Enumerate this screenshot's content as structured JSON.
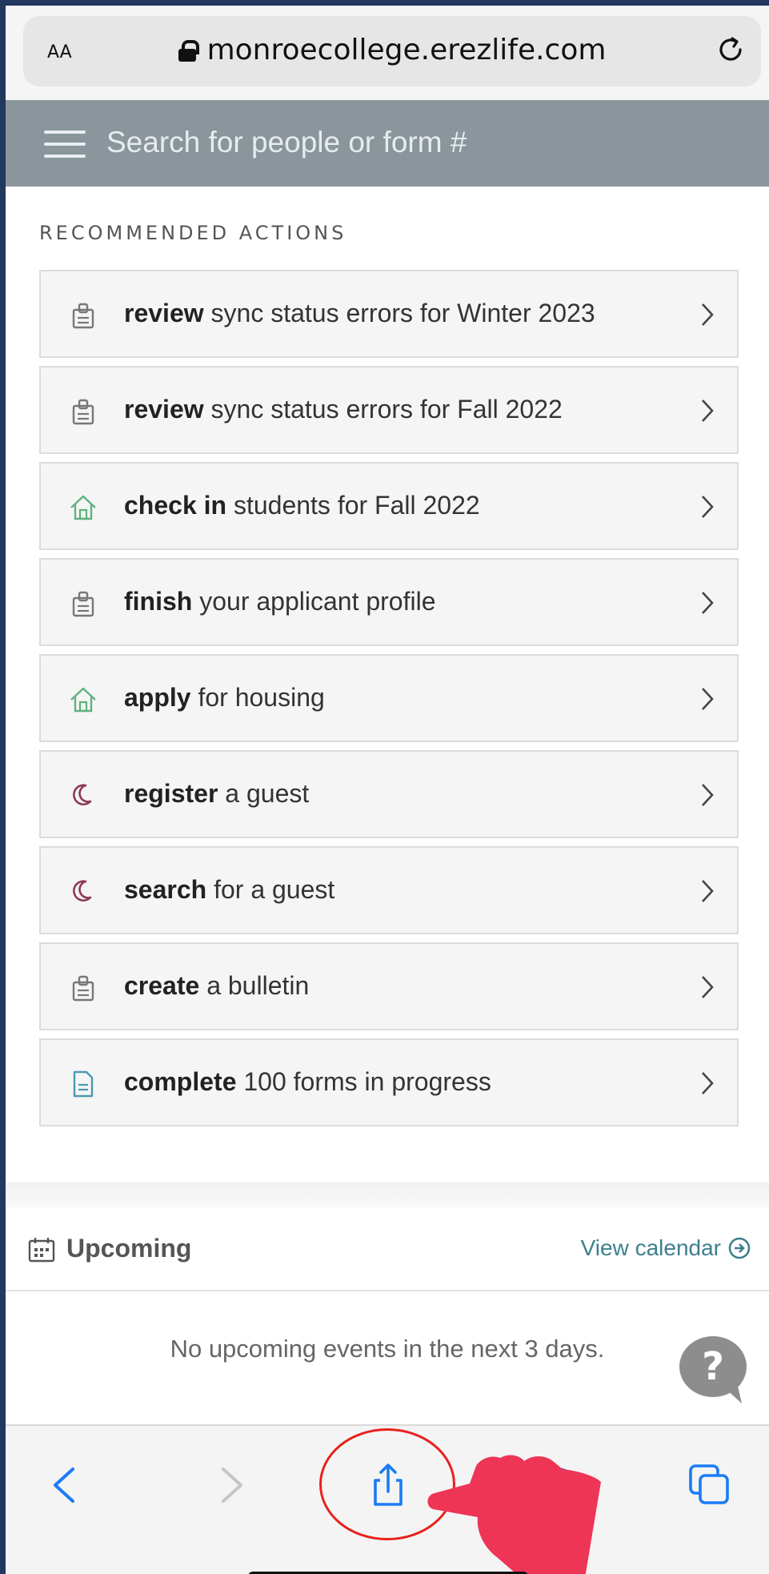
{
  "browser": {
    "text_size_label": "AA",
    "url": "monroecollege.erezlife.com"
  },
  "header": {
    "search_placeholder": "Search for people or form #"
  },
  "recommended": {
    "title": "RECOMMENDED ACTIONS",
    "items": [
      {
        "verb": "review",
        "rest": " sync status errors for Winter 2023",
        "icon": "clipboard-icon"
      },
      {
        "verb": "review",
        "rest": " sync status errors for Fall 2022",
        "icon": "clipboard-icon"
      },
      {
        "verb": "check in",
        "rest": " students for Fall 2022",
        "icon": "house-icon"
      },
      {
        "verb": "finish",
        "rest": " your applicant profile",
        "icon": "clipboard-icon"
      },
      {
        "verb": "apply",
        "rest": " for housing",
        "icon": "house-icon"
      },
      {
        "verb": "register",
        "rest": " a guest",
        "icon": "moon-icon"
      },
      {
        "verb": "search",
        "rest": " for a guest",
        "icon": "moon-icon"
      },
      {
        "verb": "create",
        "rest": " a bulletin",
        "icon": "clipboard-icon"
      },
      {
        "verb": "complete",
        "rest": " 100 forms in progress",
        "icon": "document-icon"
      }
    ]
  },
  "upcoming": {
    "label": "Upcoming",
    "view_calendar": "View calendar",
    "empty_message": "No upcoming events in the next 3 days."
  },
  "help": {
    "label": "?"
  },
  "colors": {
    "header_bg": "#8a959c",
    "house_icon": "#5fb27f",
    "moon_icon": "#8c3a55",
    "document_icon": "#4a9ab0",
    "link": "#3e7f8e",
    "toolbar_blue": "#1a7cf5",
    "annotation_red": "#e8201d",
    "hand_pink": "#ee3556"
  }
}
